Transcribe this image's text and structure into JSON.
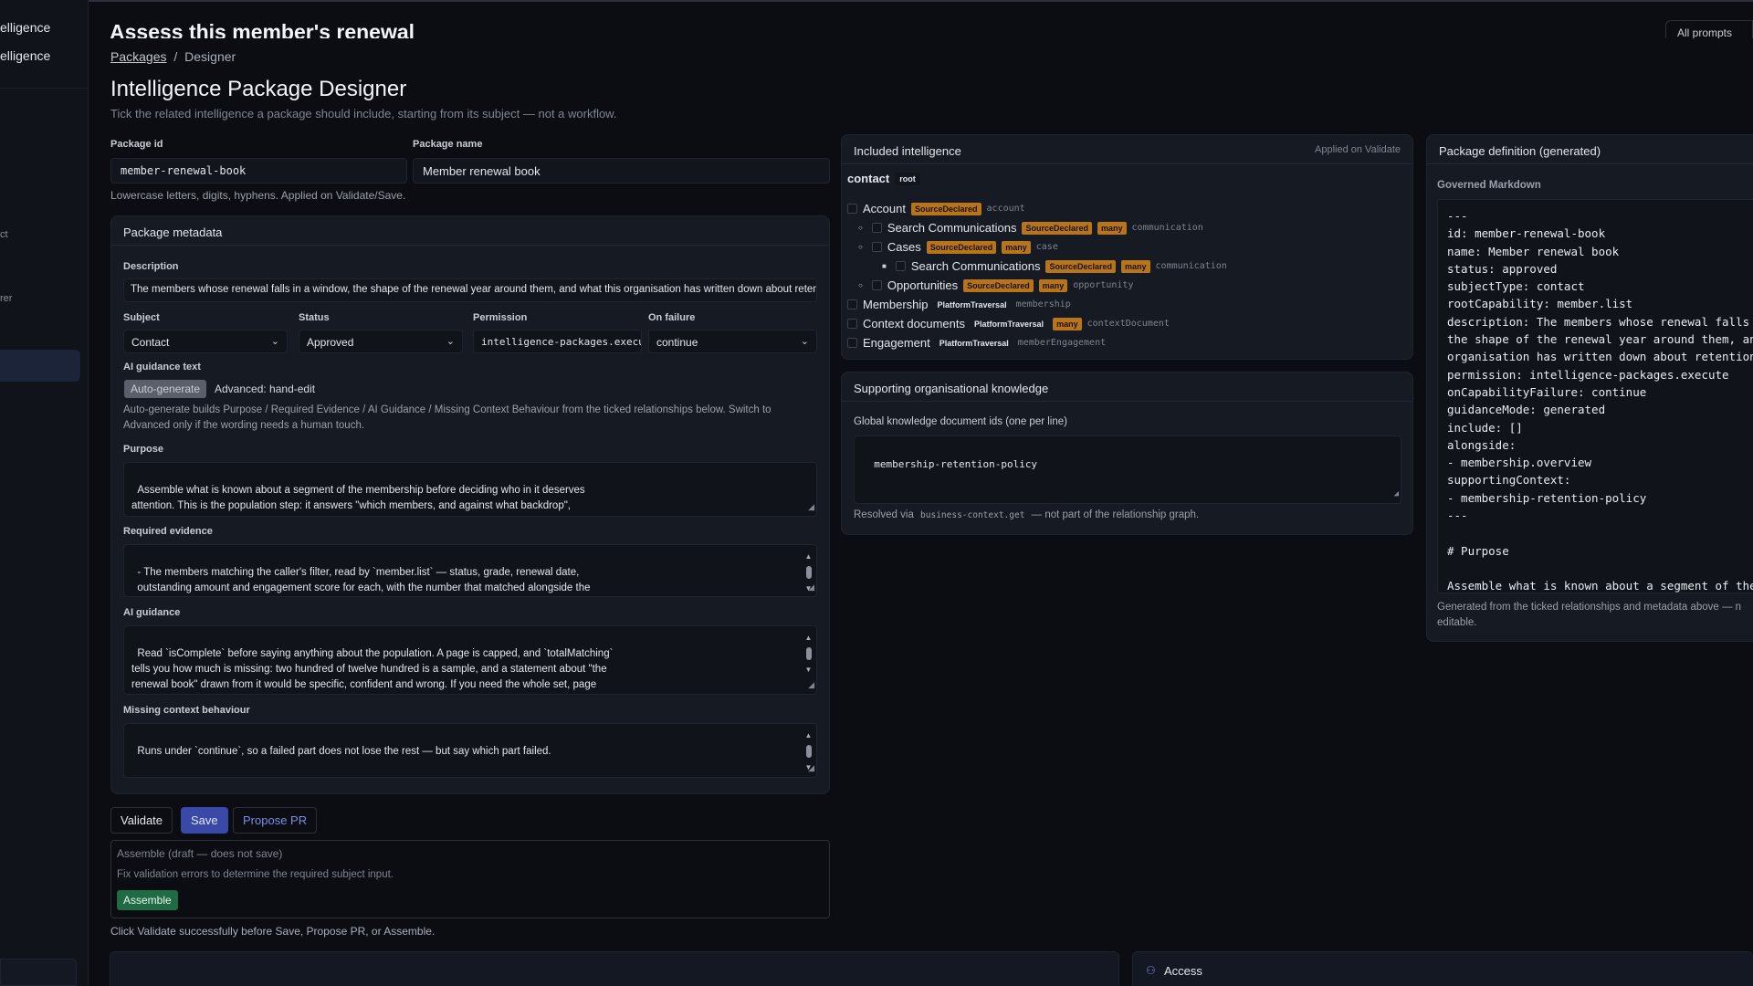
{
  "sidebar": {
    "items": [
      "elligence",
      "elligence"
    ],
    "fragments": [
      "ct",
      "rer"
    ]
  },
  "top": {
    "title": "Assess this member's renewal",
    "all_prompts": "All prompts"
  },
  "breadcrumb": {
    "root": "Packages",
    "sep": "/",
    "current": "Designer"
  },
  "page": {
    "title": "Intelligence Package Designer",
    "subtitle": "Tick the related intelligence a package should include, starting from its subject — not a workflow."
  },
  "form": {
    "package_id_label": "Package id",
    "package_id_value": "member-renewal-book",
    "package_name_label": "Package name",
    "package_name_value": "Member renewal book",
    "id_hint": "Lowercase letters, digits, hyphens. Applied on Validate/Save."
  },
  "metadata": {
    "title": "Package metadata",
    "description_label": "Description",
    "description_value": "The members whose renewal falls in a window, the shape of the renewal year around them, and what this organisation has written down about retention risk",
    "subject_label": "Subject",
    "subject_value": "Contact",
    "status_label": "Status",
    "status_value": "Approved",
    "permission_label": "Permission",
    "permission_value": "intelligence-packages.execute",
    "onfailure_label": "On failure",
    "onfailure_value": "continue",
    "ai_guidance_text_label": "AI guidance text",
    "auto_generate": "Auto-generate",
    "advanced": "Advanced: hand-edit",
    "auto_help": "Auto-generate builds Purpose / Required Evidence / AI Guidance / Missing Context Behaviour from the ticked relationships below. Switch to Advanced only if the wording needs a human touch.",
    "purpose_label": "Purpose",
    "purpose_value": "Assemble what is known about a segment of the membership before deciding who in it deserves\nattention. This is the population step: it answers \"which members, and against what backdrop\",\nand deliberately not \"what should be done about any one of them\".",
    "evidence_label": "Required evidence",
    "evidence_value": "- The members matching the caller's filter, read by `member.list` — status, grade, renewal date,\n  outstanding amount and engagement score for each, with the number that matched alongside the\n  number returned.",
    "ai_guidance_label": "AI guidance",
    "ai_guidance_value": "Read `isComplete` before saying anything about the population. A page is capped, and `totalMatching`\ntells you how much is missing: two hundred of twelve hundred is a sample, and a statement about \"the\nrenewal book\" drawn from it would be specific, confident and wrong. If you need the whole set, page\nit; if you cannot, say what you saw and what you did not.",
    "missing_label": "Missing context behaviour",
    "missing_value": "Runs under `continue`, so a failed part does not lose the rest — but say which part failed.\n\nA missing retention-risk document means this organisation has not written its definition down. That"
  },
  "actions": {
    "validate": "Validate",
    "save": "Save",
    "propose_pr": "Propose PR",
    "assemble_title": "Assemble (draft — does not save)",
    "assemble_hint": "Fix validation errors to determine the required subject input.",
    "assemble_button": "Assemble",
    "footer_hint": "Click Validate successfully before Save, Propose PR, or Assemble."
  },
  "included": {
    "title": "Included intelligence",
    "applied": "Applied on Validate",
    "root_label": "contact",
    "root_tag": "root",
    "rows": [
      {
        "label": "Account",
        "tags": [
          "SourceDeclared"
        ],
        "key": "account"
      },
      {
        "label": "Search Communications",
        "tags": [
          "SourceDeclared",
          "many"
        ],
        "key": "communication"
      },
      {
        "label": "Cases",
        "tags": [
          "SourceDeclared",
          "many"
        ],
        "key": "case"
      },
      {
        "label": "Search Communications",
        "tags": [
          "SourceDeclared",
          "many"
        ],
        "key": "communication"
      },
      {
        "label": "Opportunities",
        "tags": [
          "SourceDeclared",
          "many"
        ],
        "key": "opportunity"
      },
      {
        "label": "Membership",
        "tags": [
          "PlatformTraversal"
        ],
        "key": "membership"
      },
      {
        "label": "Context documents",
        "tags": [
          "PlatformTraversal",
          "many"
        ],
        "key": "contextDocument"
      },
      {
        "label": "Engagement",
        "tags": [
          "PlatformTraversal"
        ],
        "key": "memberEngagement"
      }
    ]
  },
  "supporting": {
    "title": "Supporting organisational knowledge",
    "label": "Global knowledge document ids (one per line)",
    "value": "membership-retention-policy",
    "resolved_prefix": "Resolved via",
    "resolved_code": "business-context.get",
    "resolved_suffix": "— not part of the relationship graph."
  },
  "definition": {
    "title": "Package definition (generated)",
    "governed": "Governed Markdown",
    "lines": [
      "---",
      "id: member-renewal-book",
      "name: Member renewal book",
      "status: approved",
      "subjectType: contact",
      "rootCapability: member.list",
      "description: The members whose renewal falls in a",
      "the shape of the renewal year around them, and w",
      "organisation has written down about retention ri",
      "permission: intelligence-packages.execute",
      "onCapabilityFailure: continue",
      "guidanceMode: generated",
      "include: []",
      "alongside:",
      "- membership.overview",
      "supportingContext:",
      "- membership-retention-policy",
      "---",
      "",
      "# Purpose",
      "",
      "Assemble what is known about a segment of the mem"
    ],
    "footer": "Generated from the ticked relationships and metadata above — n editable."
  },
  "access": {
    "label": "Access"
  },
  "colors": {
    "accent": "#3a49a8",
    "badge": "#b8741a",
    "success": "#1f6b44"
  }
}
